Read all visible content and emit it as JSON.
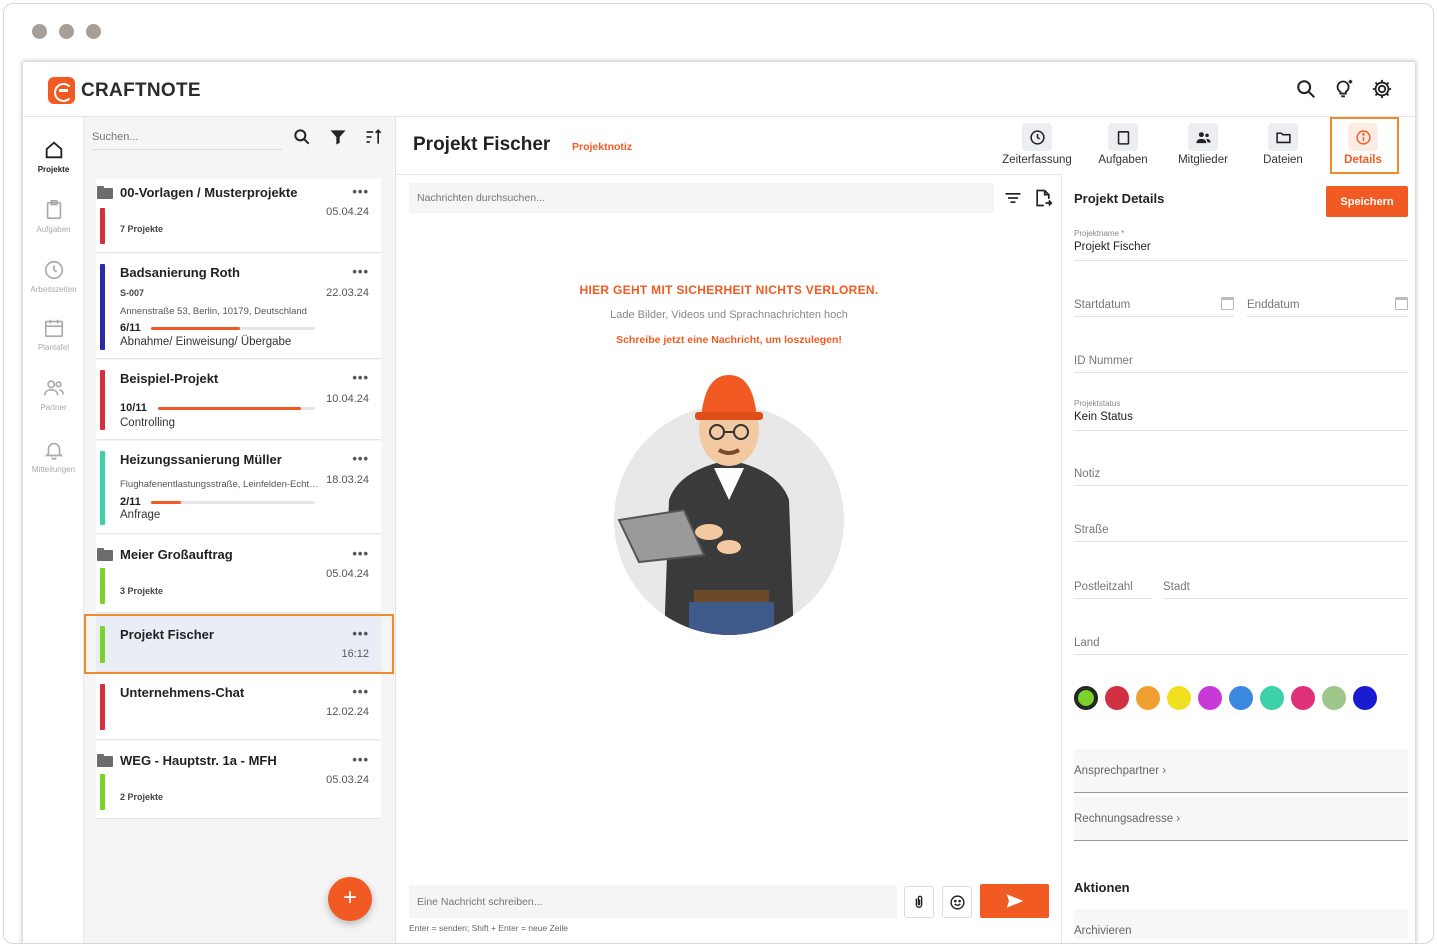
{
  "app": {
    "brand": "CRAFTNOTE"
  },
  "nav": [
    {
      "label": "Projekte",
      "icon": "home-icon",
      "active": true
    },
    {
      "label": "Aufgaben",
      "icon": "clipboard-icon"
    },
    {
      "label": "Arbeitszeiten",
      "icon": "clock-icon"
    },
    {
      "label": "Plantafel",
      "icon": "calendar-icon"
    },
    {
      "label": "Partner",
      "icon": "people-icon"
    },
    {
      "label": "Mitteilungen",
      "icon": "bell-icon"
    }
  ],
  "list": {
    "search_placeholder": "Suchen...",
    "items": [
      {
        "title": "00-Vorlagen / Musterprojekte",
        "date": "05.04.24",
        "sub": "7 Projekte",
        "color": "#d03040",
        "folder": true
      },
      {
        "title": "Badsanierung Roth",
        "date": "22.03.24",
        "code": "S-007",
        "address": "Annenstraße 53, Berlin, 10179, Deutschland",
        "progress_text": "6/11",
        "progress": 0.545,
        "status": "Abnahme/ Einweisung/ Übergabe",
        "color": "#2a2aa8"
      },
      {
        "title": "Beispiel-Projekt",
        "date": "10.04.24",
        "progress_text": "10/11",
        "progress": 0.91,
        "status": "Controlling",
        "color": "#d03040"
      },
      {
        "title": "Heizungssanierung Müller",
        "date": "18.03.24",
        "address": "Flughafenentlastungsstraße, Leinfelden-Echterdingen",
        "progress_text": "2/11",
        "progress": 0.18,
        "status": "Anfrage",
        "color": "#3cd1a8"
      },
      {
        "title": "Meier Großauftrag",
        "date": "05.04.24",
        "sub": "3 Projekte",
        "color": "#7cd12a",
        "folder": true
      },
      {
        "title": "Projekt Fischer",
        "date": "16:12",
        "color": "#7cd12a",
        "selected": true
      },
      {
        "title": "Unternehmens-Chat",
        "date": "12.02.24",
        "color": "#d03040"
      },
      {
        "title": "WEG - Hauptstr. 1a - MFH",
        "date": "05.03.24",
        "sub": "2 Projekte",
        "color": "#7cd12a",
        "folder": true
      }
    ],
    "more": "•••",
    "fab": "+"
  },
  "main": {
    "title": "Projekt Fischer",
    "subtitle": "Projektnotiz",
    "tabs": [
      {
        "label": "Zeiterfassung",
        "icon": "clock-icon"
      },
      {
        "label": "Aufgaben",
        "icon": "clipboard-icon"
      },
      {
        "label": "Mitglieder",
        "icon": "people-icon"
      },
      {
        "label": "Dateien",
        "icon": "folder-icon"
      },
      {
        "label": "Details",
        "icon": "info-icon",
        "active": true
      }
    ],
    "msg_search_placeholder": "Nachrichten durchsuchen...",
    "empty_heading": "HIER GEHT MIT SICHERHEIT NICHTS VERLOREN.",
    "empty_sub": "Lade Bilder, Videos und Sprachnachrichten hoch",
    "empty_cta": "Schreibe jetzt eine Nachricht, um loszulegen!",
    "composer_placeholder": "Eine Nachricht schreiben...",
    "hint": "Enter = senden; Shift + Enter = neue Zeile"
  },
  "details": {
    "title": "Projekt Details",
    "save": "Speichern",
    "name_label": "Projektname *",
    "name_value": "Projekt Fischer",
    "start": "Startdatum",
    "end": "Enddatum",
    "id": "ID Nummer",
    "status_label": "Projektstatus",
    "status_value": "Kein Status",
    "note": "Notiz",
    "street": "Straße",
    "zip": "Postleitzahl",
    "city": "Stadt",
    "country": "Land",
    "colors": [
      "#7cd12a",
      "#d03040",
      "#f0a030",
      "#f0e020",
      "#c83ad8",
      "#3a88e0",
      "#3cd1a8",
      "#e0307a",
      "#9fc68a",
      "#1a1ad0"
    ],
    "contact": "Ansprechpartner",
    "billing": "Rechnungsadresse",
    "actions": "Aktionen",
    "archive": "Archivieren"
  }
}
